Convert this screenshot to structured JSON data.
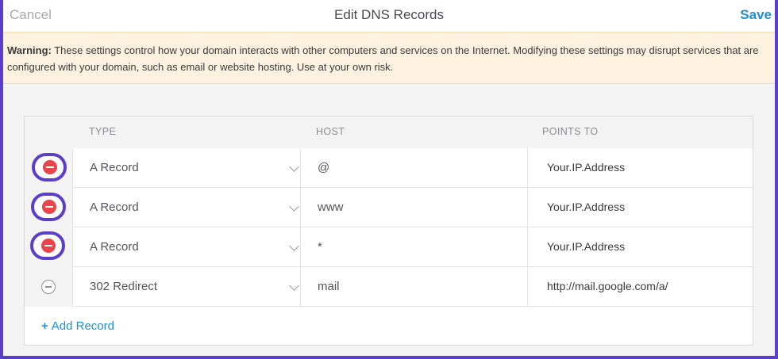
{
  "header": {
    "cancel_label": "Cancel",
    "title": "Edit DNS Records",
    "save_label": "Save"
  },
  "warning": {
    "prefix": "Warning:",
    "text": " These settings control how your domain interacts with other computers and services on the Internet. Modifying these settings may disrupt services that are configured with your domain, such as email or website hosting. Use at your own risk."
  },
  "table": {
    "columns": [
      "TYPE",
      "HOST",
      "POINTS TO"
    ],
    "rows": [
      {
        "type": "A Record",
        "host": "@",
        "points_to": "Your.IP.Address"
      },
      {
        "type": "A Record",
        "host": "www",
        "points_to": "Your.IP.Address"
      },
      {
        "type": "A Record",
        "host": "*",
        "points_to": "Your.IP.Address"
      },
      {
        "type": "302 Redirect",
        "host": "mail",
        "points_to": "http://mail.google.com/a/"
      }
    ]
  },
  "add_record_label": "Add Record",
  "colors": {
    "accent": "#1e8fd6",
    "highlight_ring": "#5b3fc9",
    "remove_red": "#e8444a",
    "warning_bg": "#fdf1e0"
  }
}
